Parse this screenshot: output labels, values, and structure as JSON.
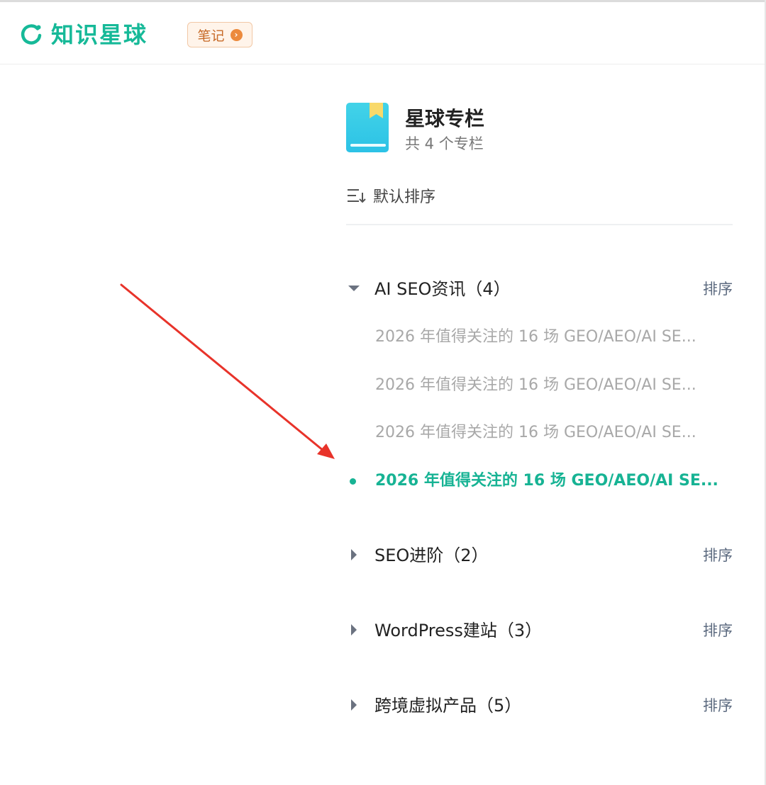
{
  "header": {
    "logo_text": "知识星球",
    "notes_label": "笔记"
  },
  "panel": {
    "title": "星球专栏",
    "subtitle": "共 4 个专栏",
    "sort_label": "默认排序"
  },
  "sections": [
    {
      "title": "AI SEO资讯（4）",
      "sort_label": "排序",
      "expanded": true,
      "articles": [
        {
          "title": "2026 年值得关注的 16 场 GEO/AEO/AI SE...",
          "active": false
        },
        {
          "title": "2026 年值得关注的 16 场 GEO/AEO/AI SE...",
          "active": false
        },
        {
          "title": "2026 年值得关注的 16 场 GEO/AEO/AI SE...",
          "active": false
        },
        {
          "title": "2026 年值得关注的 16 场 GEO/AEO/AI SE...",
          "active": true
        }
      ]
    },
    {
      "title": "SEO进阶（2）",
      "sort_label": "排序",
      "expanded": false
    },
    {
      "title": "WordPress建站（3）",
      "sort_label": "排序",
      "expanded": false
    },
    {
      "title": "跨境虚拟产品（5）",
      "sort_label": "排序",
      "expanded": false
    }
  ],
  "colors": {
    "brand": "#16b998",
    "active_article": "#17b394",
    "inactive_article": "#a8a8a8",
    "annotation_arrow": "#e8332a"
  }
}
